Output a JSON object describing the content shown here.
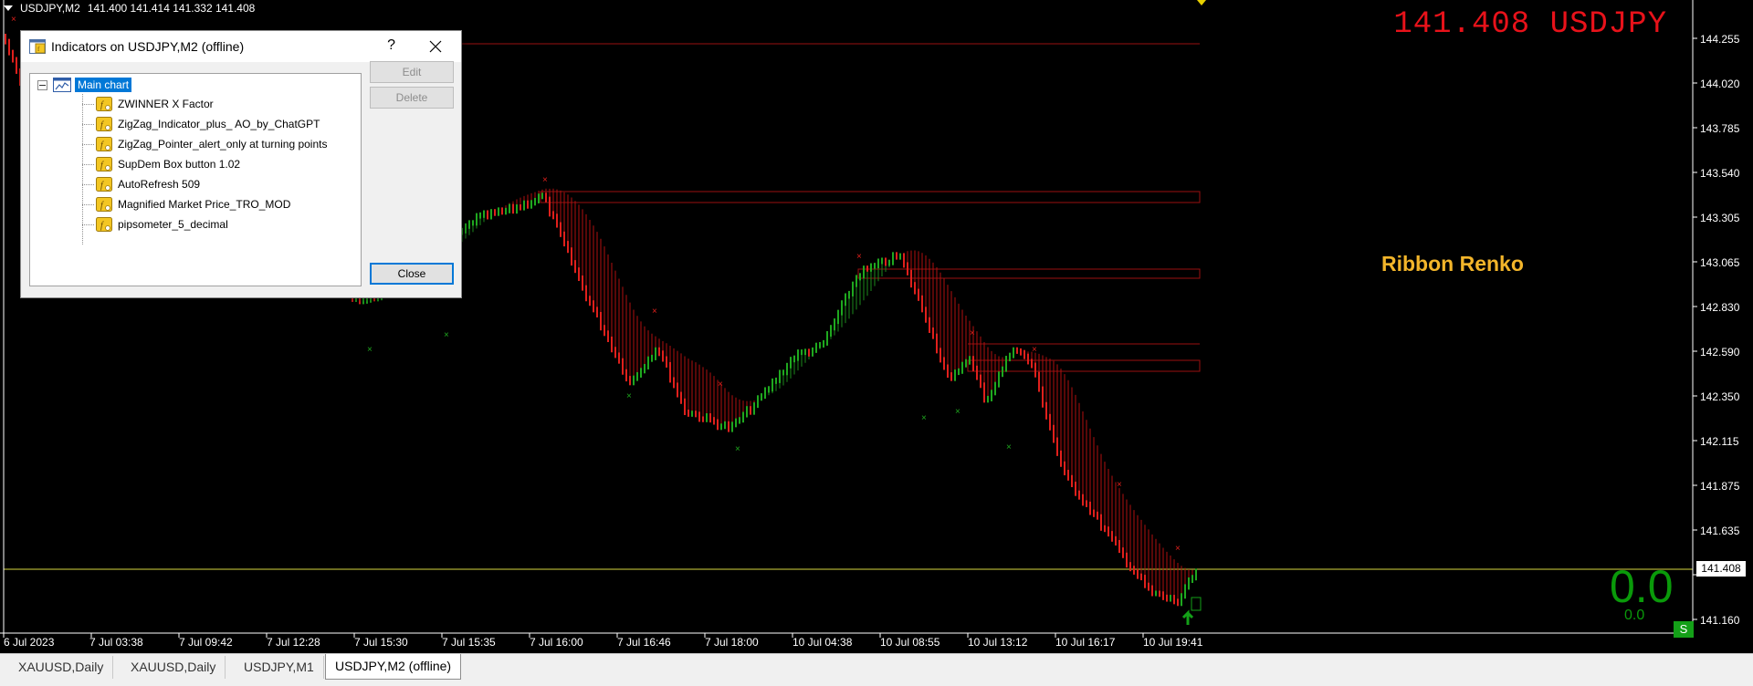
{
  "chart": {
    "symbol_tf": "USDJPY,M2",
    "ohlc": "141.400 141.414 141.332 141.408",
    "big_price": "141.408 USDJPY",
    "ribbon_label": "Ribbon Renko",
    "pips_big": "0.0",
    "pips_small": "0.0",
    "badge": "S",
    "current_price": "141.408",
    "price_axis": [
      "144.255",
      "144.020",
      "143.785",
      "143.540",
      "143.305",
      "143.065",
      "142.830",
      "142.590",
      "142.350",
      "142.115",
      "141.875",
      "141.635",
      "141.160"
    ],
    "time_axis": [
      "6 Jul 2023",
      "7 Jul 03:38",
      "7 Jul 09:42",
      "7 Jul 12:28",
      "7 Jul 15:30",
      "7 Jul 15:35",
      "7 Jul 16:00",
      "7 Jul 16:46",
      "7 Jul 18:00",
      "10 Jul 04:38",
      "10 Jul 08:55",
      "10 Jul 13:12",
      "10 Jul 16:17",
      "10 Jul 19:41"
    ],
    "colors": {
      "up": "#1fa81f",
      "down": "#e0201c",
      "ribbon": "#b01010",
      "price_line": "#d8d840",
      "zone": "#9a1010"
    }
  },
  "dialog": {
    "title": "Indicators on USDJPY,M2 (offline)",
    "help": "?",
    "root": "Main chart",
    "indicators": [
      "ZWINNER X Factor",
      "ZigZag_Indicator_plus_ AO_by_ChatGPT",
      "ZigZag_Pointer_alert_only at turning points",
      "SupDem Box button 1.02",
      "AutoRefresh 509",
      "Magnified Market Price_TRO_MOD",
      "pipsometer_5_decimal"
    ],
    "edit": "Edit",
    "delete": "Delete",
    "close": "Close"
  },
  "tabs": [
    "XAUUSD,Daily",
    "XAUUSD,Daily",
    "USDJPY,M1",
    "USDJPY,M2 (offline)"
  ]
}
